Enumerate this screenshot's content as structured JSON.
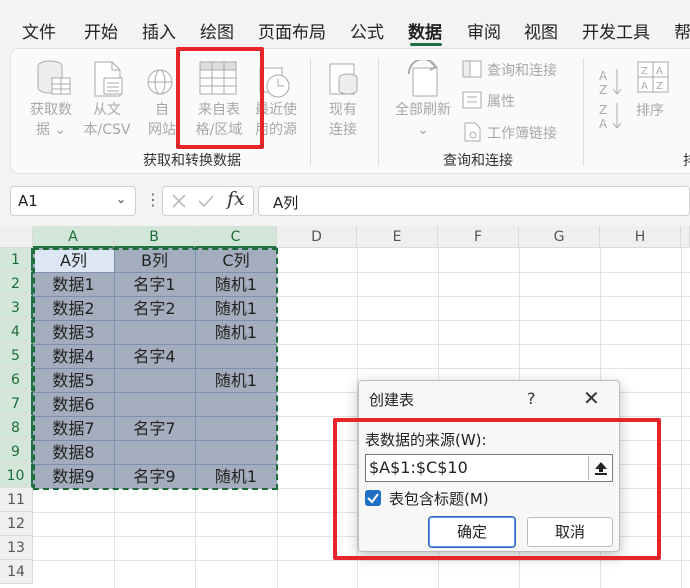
{
  "ribbon_tabs": [
    "文件",
    "开始",
    "插入",
    "绘图",
    "页面布局",
    "公式",
    "数据",
    "审阅",
    "视图",
    "开发工具",
    "帮"
  ],
  "active_tab": "数据",
  "ribbon": {
    "get_data": {
      "line1": "获取数",
      "line2": "据 ⌄"
    },
    "from_text": {
      "line1": "从文",
      "line2": "本/CSV"
    },
    "from_web": {
      "line1": "自",
      "line2": "网站"
    },
    "from_table": {
      "line1": "来自表",
      "line2": "格/区域"
    },
    "recent_sources": {
      "line1": "最近使",
      "line2": "用的源"
    },
    "existing_connections": {
      "line1": "现有",
      "line2": "连接"
    },
    "refresh_all": {
      "line1": "全部刷新",
      "line2": "⌄"
    },
    "queries_connections": "查询和连接",
    "properties": "属性",
    "workbook_links": "工作簿链接",
    "sort": "排序",
    "group1_label": "获取和转换数据",
    "group2_label": "查询和连接",
    "group3_label": "排"
  },
  "formula_bar": {
    "name_box": "A1",
    "fx": "fx",
    "content": "A列"
  },
  "grid": {
    "columns": [
      "A",
      "B",
      "C",
      "D",
      "E",
      "F",
      "G",
      "H"
    ],
    "rows": [
      "1",
      "2",
      "3",
      "4",
      "5",
      "6",
      "7",
      "8",
      "9",
      "10",
      "11",
      "12",
      "13",
      "14"
    ],
    "cells": [
      [
        "A列",
        "B列",
        "C列"
      ],
      [
        "数据1",
        "名字1",
        "随机1"
      ],
      [
        "数据2",
        "名字2",
        "随机1"
      ],
      [
        "数据3",
        "",
        "随机1"
      ],
      [
        "数据4",
        "名字4",
        ""
      ],
      [
        "数据5",
        "",
        "随机1"
      ],
      [
        "数据6",
        "",
        ""
      ],
      [
        "数据7",
        "名字7",
        ""
      ],
      [
        "数据8",
        "",
        ""
      ],
      [
        "数据9",
        "名字9",
        "随机1"
      ]
    ]
  },
  "dialog": {
    "title": "创建表",
    "help": "?",
    "close": "✕",
    "source_label": "表数据的来源(W):",
    "source_value": "$A$1:$C$10",
    "has_headers_label": "表包含标题(M)",
    "has_headers_checked": true,
    "ok": "确定",
    "cancel": "取消"
  },
  "colors": {
    "accent_green": "#217346",
    "highlight_red": "#e8242b",
    "selection_fill": "#a4adbd",
    "checkbox_blue": "#1f6fc5"
  }
}
